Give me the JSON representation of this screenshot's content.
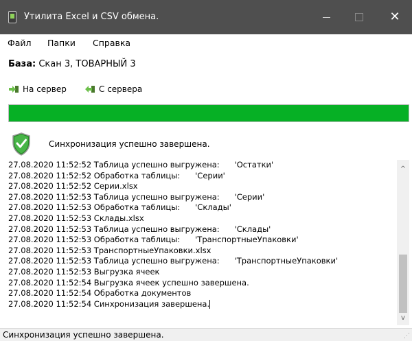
{
  "window": {
    "title": "Утилита Excel и CSV обмена.",
    "icon": "app-phone-icon",
    "minimize": "minimize-icon",
    "maximize": "maximize-icon",
    "close": "close-icon",
    "close_glyph": "✕"
  },
  "menu": {
    "items": [
      "Файл",
      "Папки",
      "Справка"
    ]
  },
  "base": {
    "label": "База:",
    "value": "Скан 3, ТОВАРНЫЙ 3"
  },
  "toolbar": {
    "to_server": "На сервер",
    "from_server": "С сервера"
  },
  "progress": {
    "value_percent": 100,
    "color": "#06b025"
  },
  "sync": {
    "message": "Синхронизация успешно завершена.",
    "icon": "shield-check-icon"
  },
  "log": {
    "lines": [
      "27.08.2020 11:52:52 Таблица успешно выгружена:      'Остатки'",
      "27.08.2020 11:52:52 Обработка таблицы:      'Серии'",
      "27.08.2020 11:52:52 Серии.xlsx",
      "27.08.2020 11:52:53 Таблица успешно выгружена:      'Серии'",
      "27.08.2020 11:52:53 Обработка таблицы:      'Склады'",
      "27.08.2020 11:52:53 Склады.xlsx",
      "27.08.2020 11:52:53 Таблица успешно выгружена:      'Склады'",
      "27.08.2020 11:52:53 Обработка таблицы:      'ТранспортныеУпаковки'",
      "27.08.2020 11:52:53 ТранспортныеУпаковки.xlsx",
      "27.08.2020 11:52:53 Таблица успешно выгружена:      'ТранспортныеУпаковки'",
      "27.08.2020 11:52:53 Выгрузка ячеек",
      "27.08.2020 11:52:54 Выгрузка ячеек успешно завершена.",
      "27.08.2020 11:52:54 Обработка документов",
      "27.08.2020 11:52:54 Синхронизация завершена."
    ]
  },
  "scroll": {
    "up": "^",
    "down": "v"
  },
  "status": {
    "text": "Синхронизация успешно завершена."
  }
}
